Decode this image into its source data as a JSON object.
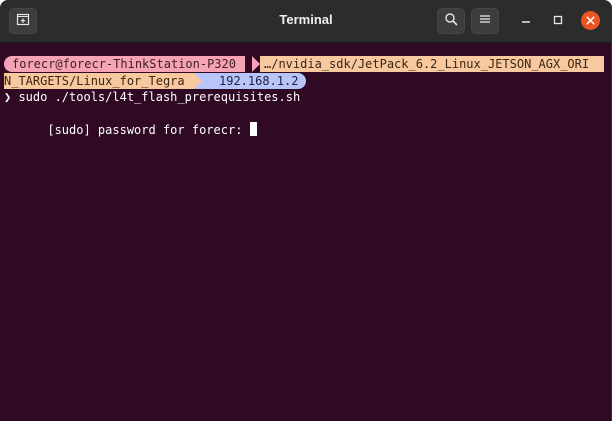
{
  "window": {
    "title": "Terminal"
  },
  "toolbar": {
    "new_tab_icon": "new-tab-icon",
    "search_icon": "search-icon",
    "menu_icon": "hamburger-menu-icon",
    "minimize_icon": "minimize-icon",
    "maximize_icon": "maximize-icon",
    "close_icon": "close-icon"
  },
  "prompt": {
    "user_host": "forecr@forecr-ThinkStation-P320",
    "path_line1": "…/nvidia_sdk/JetPack_6.2_Linux_JETSON_AGX_ORI",
    "path_line2": "N_TARGETS/Linux_for_Tegra",
    "ip": "192.168.1.2"
  },
  "terminal": {
    "command_line": "❯ sudo ./tools/l4t_flash_prerequisites.sh",
    "password_prompt": "[sudo] password for forecr: "
  },
  "colors": {
    "terminal_bg": "#300a24",
    "titlebar_bg": "#2c2c2c",
    "user_segment": "#f5a3b5",
    "path_segment": "#f8c99e",
    "ip_segment": "#b8c5f8",
    "close_button": "#e95420"
  }
}
